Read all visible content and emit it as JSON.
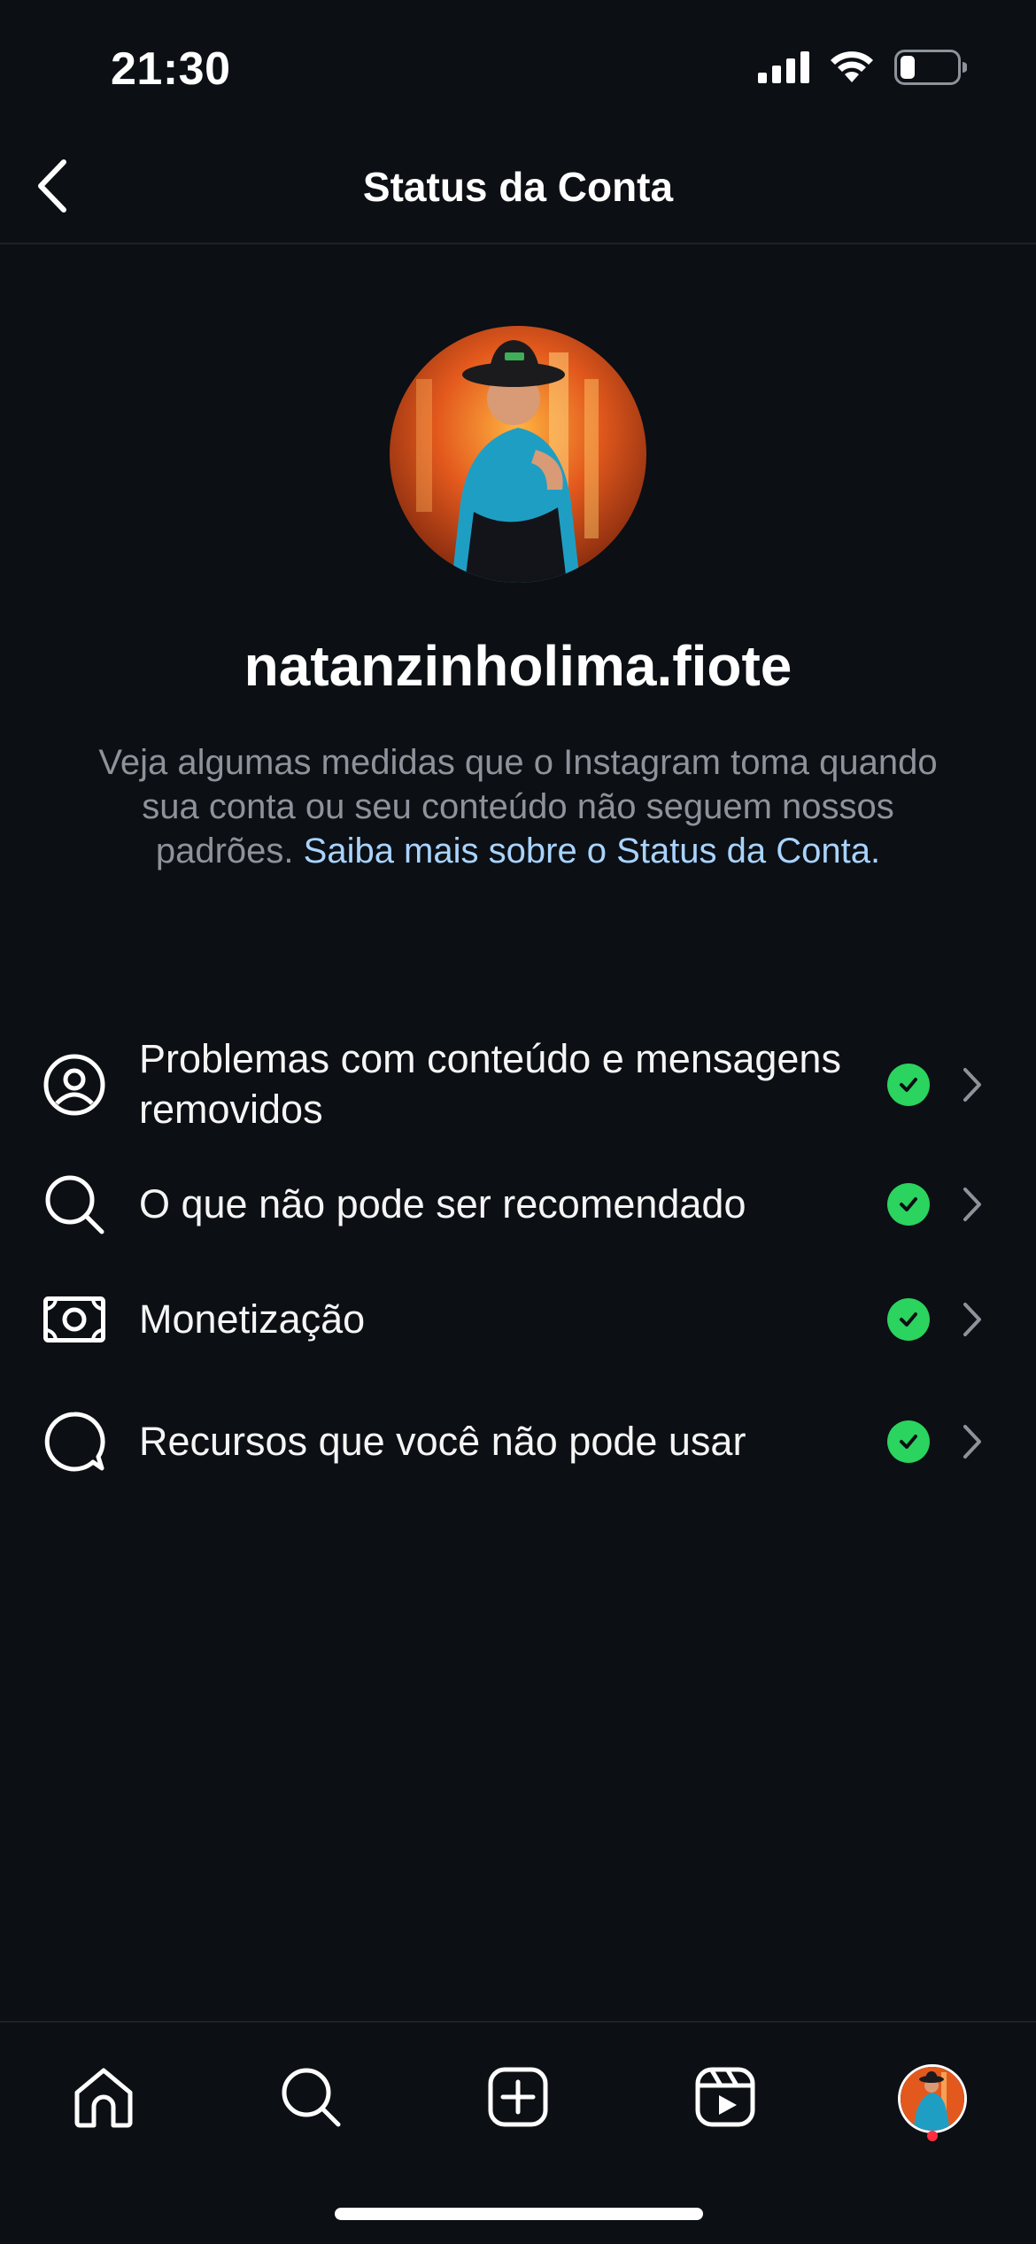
{
  "status_bar": {
    "time": "21:30",
    "icons": [
      "signal-icon",
      "wifi-icon",
      "battery-icon"
    ]
  },
  "header": {
    "title": "Status da Conta",
    "back_icon": "chevron-left-icon"
  },
  "profile": {
    "username": "natanzinholima.fiote",
    "description_text": "Veja algumas medidas que o Instagram toma quando sua conta ou seu conteúdo não seguem nossos padrões. ",
    "description_link": "Saiba mais sobre o Status da Conta."
  },
  "status_items": [
    {
      "label": "Problemas com conteúdo e mensagens removidos",
      "icon": "user-circle-icon",
      "status": "ok"
    },
    {
      "label": "O que não pode ser recomendado",
      "icon": "search-icon",
      "status": "ok"
    },
    {
      "label": "Monetização",
      "icon": "money-icon",
      "status": "ok"
    },
    {
      "label": "Recursos que você não pode usar",
      "icon": "chat-bubble-icon",
      "status": "ok"
    }
  ],
  "tab_bar": {
    "tabs": [
      "home-icon",
      "search-icon",
      "create-icon",
      "reels-icon",
      "profile-avatar"
    ],
    "has_notification": true
  },
  "colors": {
    "background": "#0c0f14",
    "check_green": "#2bd35f",
    "link": "#a8d4ff",
    "muted_text": "#8e939b",
    "notification": "#ff2d3d"
  }
}
